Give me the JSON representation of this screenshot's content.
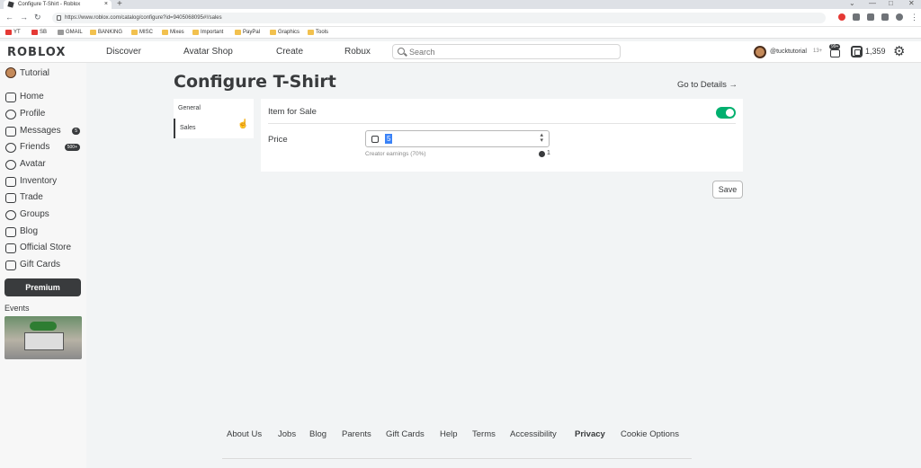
{
  "browser": {
    "tab_title": "Configure T-Shirt - Roblox",
    "new_tab": "+",
    "tab_close": "×",
    "url": "https://www.roblox.com/catalog/configure?id=9405068095#!/sales",
    "window_controls": [
      "⌄",
      "—",
      "□",
      "✕"
    ],
    "bookmarks": [
      {
        "label": "YT",
        "icon": "youtube-icon"
      },
      {
        "label": "SB",
        "icon": "youtube-icon"
      },
      {
        "label": "GMAIL",
        "icon": "gmail-icon"
      },
      {
        "label": "BANKING",
        "icon": "folder-icon"
      },
      {
        "label": "MISC",
        "icon": "folder-icon"
      },
      {
        "label": "Mixes",
        "icon": "folder-icon"
      },
      {
        "label": "Important",
        "icon": "folder-icon"
      },
      {
        "label": "PayPal",
        "icon": "folder-icon"
      },
      {
        "label": "Graphics",
        "icon": "folder-icon"
      },
      {
        "label": "Tools",
        "icon": "folder-icon"
      }
    ]
  },
  "topnav": {
    "logo": "ROBLOX",
    "links": [
      "Discover",
      "Avatar Shop",
      "Create",
      "Robux"
    ],
    "search_placeholder": "Search",
    "username": "@tucktutorial",
    "age": "13+",
    "notif_badge": "99+",
    "robux": "1,359"
  },
  "sidebar": {
    "user": "Tutorial",
    "items": [
      {
        "label": "Home",
        "icon": "home-icon"
      },
      {
        "label": "Profile",
        "icon": "profile-icon"
      },
      {
        "label": "Messages",
        "icon": "messages-icon",
        "count": "5"
      },
      {
        "label": "Friends",
        "icon": "friends-icon",
        "count": "500+"
      },
      {
        "label": "Avatar",
        "icon": "avatar-icon"
      },
      {
        "label": "Inventory",
        "icon": "inventory-icon"
      },
      {
        "label": "Trade",
        "icon": "trade-icon"
      },
      {
        "label": "Groups",
        "icon": "groups-icon"
      },
      {
        "label": "Blog",
        "icon": "blog-icon"
      },
      {
        "label": "Official Store",
        "icon": "store-icon"
      },
      {
        "label": "Gift Cards",
        "icon": "gift-card-icon"
      }
    ],
    "premium": "Premium",
    "events": "Events"
  },
  "main": {
    "title": "Configure T-Shirt",
    "go_to_details": "Go to Details →",
    "subnav": [
      "General",
      "Sales"
    ],
    "active_subnav": "Sales",
    "item_for_sale_label": "Item for Sale",
    "item_for_sale_on": true,
    "price_label": "Price",
    "price_value": "5",
    "creator_earnings_label": "Creator earnings (70%)",
    "creator_earnings_value": "1",
    "save": "Save"
  },
  "footer": {
    "links": [
      "About Us",
      "Jobs",
      "Blog",
      "Parents",
      "Gift Cards",
      "Help",
      "Terms",
      "Accessibility",
      "Privacy",
      "Cookie Options"
    ]
  },
  "colors": {
    "toggle_on": "#00b06f",
    "text": "#393b3d",
    "background": "#f2f4f5"
  }
}
